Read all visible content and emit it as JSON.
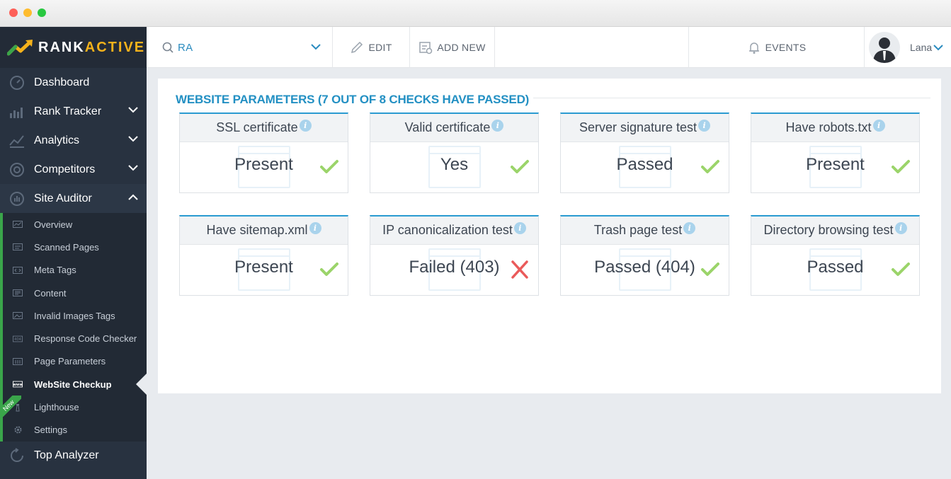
{
  "brand": {
    "rank": "RANK",
    "active": "ACTIVE"
  },
  "sidebar": {
    "items": [
      {
        "label": "Dashboard",
        "icon": "speedometer-icon",
        "chevron": ""
      },
      {
        "label": "Rank Tracker",
        "icon": "bar-chart-icon",
        "chevron": "down"
      },
      {
        "label": "Analytics",
        "icon": "analytics-chart-icon",
        "chevron": "down"
      },
      {
        "label": "Competitors",
        "icon": "target-icon",
        "chevron": "down"
      },
      {
        "label": "Site Auditor",
        "icon": "audit-icon",
        "chevron": "up"
      }
    ],
    "site_auditor_items": [
      {
        "label": "Overview",
        "icon": "overview-icon"
      },
      {
        "label": "Scanned Pages",
        "icon": "scanned-pages-icon"
      },
      {
        "label": "Meta Tags",
        "icon": "code-tag-icon"
      },
      {
        "label": "Content",
        "icon": "content-icon"
      },
      {
        "label": "Invalid Images Tags",
        "icon": "image-icon"
      },
      {
        "label": "Response Code Checker",
        "icon": "404-icon"
      },
      {
        "label": "Page Parameters",
        "icon": "parameters-icon"
      },
      {
        "label": "WebSite Checkup",
        "icon": "www-icon",
        "active": true
      },
      {
        "label": "Lighthouse",
        "icon": "lighthouse-icon",
        "badge": "New"
      },
      {
        "label": "Settings",
        "icon": "gear-icon"
      }
    ],
    "bottom_item": {
      "label": "Top Analyzer",
      "icon": "top-analyzer-icon"
    }
  },
  "topbar": {
    "project": "RA",
    "edit": "EDIT",
    "add_new": "ADD NEW",
    "events": "EVENTS",
    "user": "Lana"
  },
  "main": {
    "title": "WEBSITE PARAMETERS (7 OUT OF 8 CHECKS HAVE PASSED)",
    "checks": [
      {
        "name": "SSL certificate",
        "value": "Present",
        "status": "pass"
      },
      {
        "name": "Valid certificate",
        "value": "Yes",
        "status": "pass"
      },
      {
        "name": "Server signature test",
        "value": "Passed",
        "status": "pass"
      },
      {
        "name": "Have robots.txt",
        "value": "Present",
        "status": "pass"
      },
      {
        "name": "Have sitemap.xml",
        "value": "Present",
        "status": "pass"
      },
      {
        "name": "IP canonicalization test",
        "value": "Failed (403)",
        "status": "fail"
      },
      {
        "name": "Trash page test",
        "value": "Passed (404)",
        "status": "pass"
      },
      {
        "name": "Directory browsing test",
        "value": "Passed",
        "status": "pass"
      }
    ],
    "info_glyph": "i"
  },
  "colors": {
    "accent": "#2390c3",
    "pass": "#9bd46a",
    "fail": "#ea5a5a",
    "sidebar_bg": "#283240",
    "active_green": "#3aa54a"
  }
}
